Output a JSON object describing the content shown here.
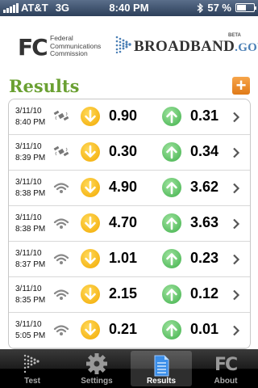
{
  "status_bar": {
    "carrier": "AT&T",
    "network": "3G",
    "time": "8:40 PM",
    "battery": "57 %",
    "battery_level": 0.57
  },
  "header": {
    "fcc_logo": "FC",
    "fcc_line1": "Federal",
    "fcc_line2": "Communications",
    "fcc_line3": "Commission",
    "broadband_main": "BROADBAND",
    "broadband_suffix": ".GOV",
    "beta": "BETA"
  },
  "results": {
    "title": "Results",
    "add_label": "+",
    "rows": [
      {
        "date": "3/11/10",
        "time": "8:40 PM",
        "connection": "cellular",
        "download": "0.90",
        "upload": "0.31"
      },
      {
        "date": "3/11/10",
        "time": "8:39 PM",
        "connection": "cellular",
        "download": "0.30",
        "upload": "0.34"
      },
      {
        "date": "3/11/10",
        "time": "8:38 PM",
        "connection": "wifi",
        "download": "4.90",
        "upload": "3.62"
      },
      {
        "date": "3/11/10",
        "time": "8:38 PM",
        "connection": "wifi",
        "download": "4.70",
        "upload": "3.63"
      },
      {
        "date": "3/11/10",
        "time": "8:37 PM",
        "connection": "wifi",
        "download": "1.01",
        "upload": "0.23"
      },
      {
        "date": "3/11/10",
        "time": "8:35 PM",
        "connection": "wifi",
        "download": "2.15",
        "upload": "0.12"
      },
      {
        "date": "3/11/10",
        "time": "5:05 PM",
        "connection": "wifi",
        "download": "0.21",
        "upload": "0.01"
      }
    ]
  },
  "tabs": [
    {
      "label": "Test",
      "icon": "test-icon",
      "active": false
    },
    {
      "label": "Settings",
      "icon": "gear-icon",
      "active": false
    },
    {
      "label": "Results",
      "icon": "results-icon",
      "active": true
    },
    {
      "label": "About",
      "icon": "fcc-icon",
      "active": false
    }
  ],
  "colors": {
    "title_green": "#6aa032",
    "add_orange": "#f08c25",
    "download_yellow": "#f2a900",
    "upload_green": "#3fb04a",
    "gov_blue": "#4a7fb5"
  }
}
